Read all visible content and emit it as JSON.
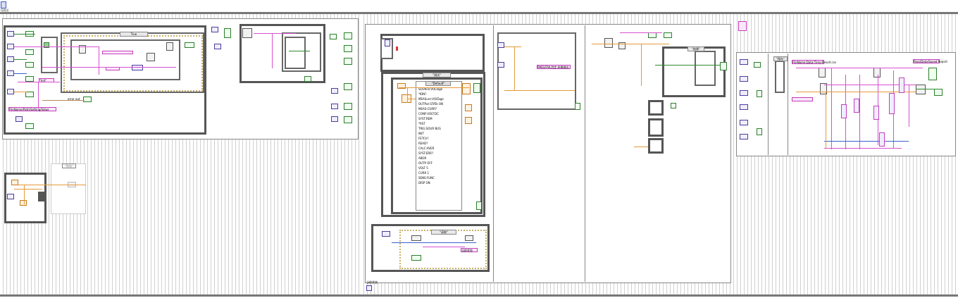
{
  "diagram": {
    "corner_label": "Q测试",
    "bottom_label": "当前状态",
    "block_diagram_background": "#ffffff",
    "wire_colors": {
      "string": "#d84fd1",
      "numeric_dbl": "#e59a38",
      "boolean": "#2f8a2f",
      "integer": "#3a5fcd",
      "cluster": "#b58c5a"
    }
  },
  "left_panel": {
    "case_label_main": "True",
    "case_label_sub": "\"Init\"",
    "string_const": "FileName/Path/Setting/Value",
    "selector_1": "\"数据\"",
    "error_out": "error out"
  },
  "center_panel": {
    "case_label": "\"测试\"",
    "sub_case_label": "\"Default\"",
    "commands": [
      "SOURce:VOLTage",
      "*IDN?",
      "MEASure:VOLTage",
      "OUTPut:STATe ON",
      "MEAS:CURR?",
      "CONF:VOLT:DC",
      "SYST:REM",
      "*RST",
      "TRIG:SOUR BUS",
      "INIT",
      "FETCh?",
      "READ?",
      "CALC:AVER",
      "SYST:ERR?",
      "ABOR",
      "OUTP OFF",
      "VOLT 5",
      "CURR 1",
      "SENS:FUNC",
      "DISP ON"
    ],
    "bottom_case_label": "\"读取\"",
    "status_text": "当前状态"
  },
  "right_panel": {
    "case_label": "\"结果\"",
    "string_const_a": "PASS/FAIL判定 结果输出",
    "string_const_b": "Fail/Pass/Result Saved"
  },
  "far_right": {
    "case_label": "\"保存\"",
    "string_const": "FileName:Data:Time:Result.csv",
    "string_const_b": "Pass/Data/Saved Report"
  }
}
